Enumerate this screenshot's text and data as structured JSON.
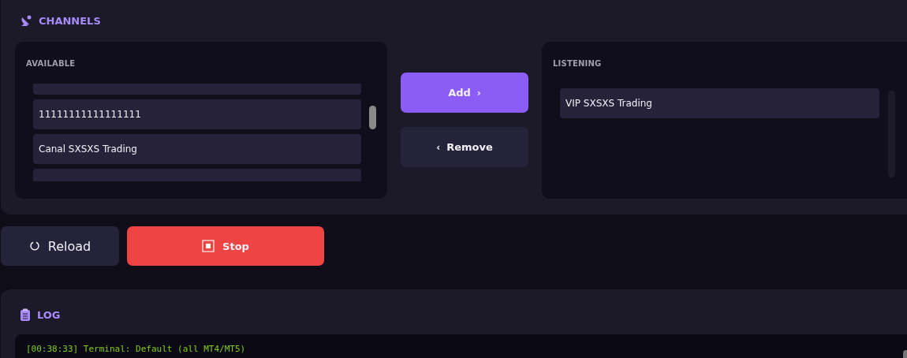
{
  "channels": {
    "title": "CHANNELS",
    "available": {
      "label": "AVAILABLE",
      "items": [
        {
          "kind": "clipped"
        },
        {
          "kind": "item",
          "name": "11111111111111111"
        },
        {
          "kind": "item",
          "name": "Canal SXSXS Trading"
        },
        {
          "kind": "clipped"
        }
      ]
    },
    "add_button": {
      "label": "Add",
      "arrow": "›"
    },
    "remove_button": {
      "label": "Remove",
      "arrow": "‹"
    },
    "listening": {
      "label": "LISTENING",
      "items": [
        {
          "kind": "item",
          "name": "VIP SXSXS Trading"
        }
      ]
    }
  },
  "actions": {
    "reload": "Reload",
    "stop": "Stop"
  },
  "log": {
    "title": "LOG",
    "lines": [
      "[00:38:33] Terminal: Default (all MT4/MT5)"
    ]
  }
}
